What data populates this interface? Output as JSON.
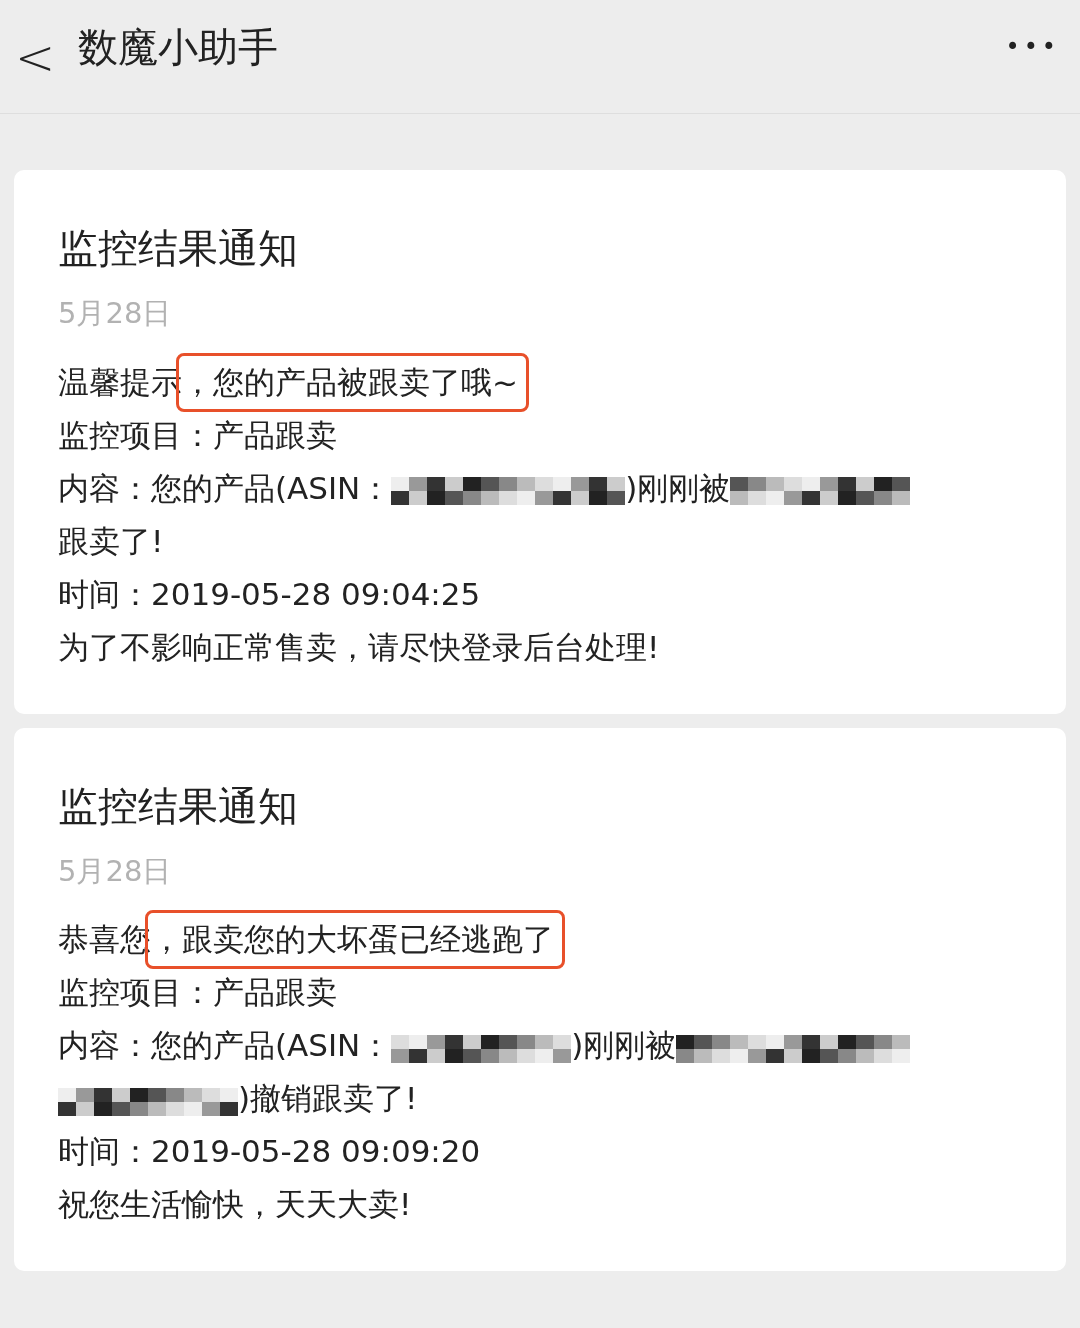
{
  "nav": {
    "back": "<",
    "title": "数魔小助手",
    "more": "•••"
  },
  "cards": [
    {
      "title": "监控结果通知",
      "date": "5月28日",
      "lines": [
        {
          "kind": "highlight",
          "lead": "温馨提示",
          "text": "，您的产品被跟卖了哦~"
        },
        {
          "kind": "text",
          "text": "监控项目：产品跟卖"
        },
        {
          "kind": "mixed",
          "parts": [
            {
              "kind": "text",
              "text": "内容：您的产品(ASIN："
            },
            {
              "kind": "redacted"
            },
            {
              "kind": "text",
              "text": ")刚刚被"
            },
            {
              "kind": "redacted"
            }
          ]
        },
        {
          "kind": "text",
          "text": "跟卖了!"
        },
        {
          "kind": "text",
          "text": "时间：2019-05-28 09:04:25"
        },
        {
          "kind": "text",
          "text": "为了不影响正常售卖，请尽快登录后台处理!"
        }
      ]
    },
    {
      "title": "监控结果通知",
      "date": "5月28日",
      "lines": [
        {
          "kind": "highlight",
          "lead": "恭喜您",
          "text": "，跟卖您的大坏蛋已经逃跑了"
        },
        {
          "kind": "text",
          "text": "监控项目：产品跟卖"
        },
        {
          "kind": "mixed",
          "parts": [
            {
              "kind": "text",
              "text": "内容：您的产品(ASIN："
            },
            {
              "kind": "redacted"
            },
            {
              "kind": "text",
              "text": ")刚刚被"
            },
            {
              "kind": "redacted"
            }
          ]
        },
        {
          "kind": "mixed",
          "parts": [
            {
              "kind": "redacted"
            },
            {
              "kind": "text",
              "text": ")撤销跟卖了!"
            }
          ]
        },
        {
          "kind": "text",
          "text": "时间：2019-05-28 09:09:20"
        },
        {
          "kind": "text",
          "text": "祝您生活愉快，天天大卖!"
        }
      ]
    }
  ]
}
